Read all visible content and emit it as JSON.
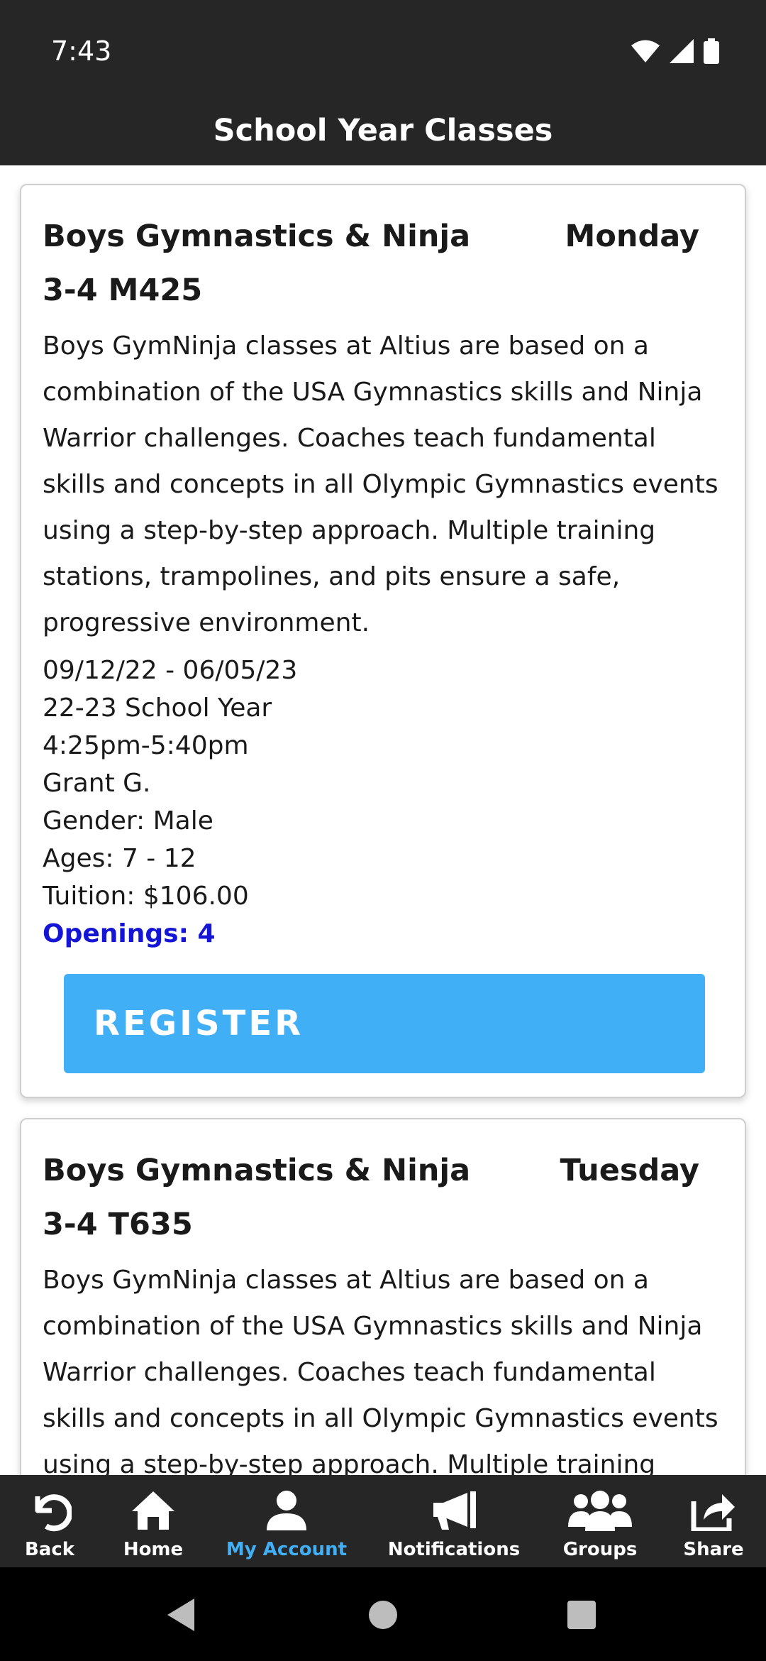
{
  "status": {
    "time": "7:43"
  },
  "header": {
    "title": "School Year Classes"
  },
  "classes": [
    {
      "title": "Boys Gymnastics & Ninja 3-4 M425",
      "day": "Monday",
      "description": "Boys GymNinja classes at Altius are based on a combination of the USA Gymnastics skills and Ninja Warrior challenges. Coaches teach fundamental skills and concepts in all Olympic Gymnastics events using a step-by-step approach. Multiple training stations, trampolines, and pits ensure a safe, progressive environment.",
      "dates": "09/12/22 - 06/05/23",
      "session": "22-23 School Year",
      "time": "4:25pm-5:40pm",
      "instructor": "Grant G.",
      "gender": "Gender: Male",
      "ages": "Ages: 7 - 12",
      "tuition": "Tuition: $106.00",
      "openings": "Openings: 4",
      "register_label": "REGISTER"
    },
    {
      "title": "Boys Gymnastics & Ninja 3-4 T635",
      "day": "Tuesday",
      "description": "Boys GymNinja classes at Altius are based on a combination of the USA Gymnastics skills and Ninja Warrior challenges. Coaches teach fundamental skills and concepts in all Olympic Gymnastics events using a step-by-step approach. Multiple training stations,"
    }
  ],
  "nav": {
    "items": [
      {
        "label": "Back",
        "icon": "back-icon"
      },
      {
        "label": "Home",
        "icon": "home-icon"
      },
      {
        "label": "My Account",
        "icon": "account-icon"
      },
      {
        "label": "Notifications",
        "icon": "megaphone-icon"
      },
      {
        "label": "Groups",
        "icon": "groups-icon"
      },
      {
        "label": "Share",
        "icon": "share-icon"
      }
    ],
    "active_color": "#41aff5"
  },
  "colors": {
    "bar": "#262626",
    "accent": "#41aff5",
    "openings": "#1515d6"
  }
}
